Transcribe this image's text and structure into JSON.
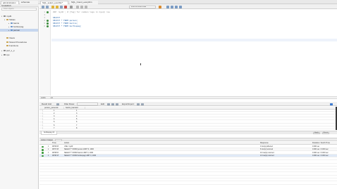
{
  "top_tabs": [
    "administration",
    "schemas",
    "SQL_select_everthin*",
    "SQL_Count_everythin"
  ],
  "sidebar": {
    "header": "SCHEMAS",
    "filter_placeholder": "Filter objects",
    "items": [
      {
        "label": "mydb",
        "level": 0,
        "icon": "database-icon",
        "expanded": true
      },
      {
        "label": "Tables",
        "level": 1,
        "icon": "folder-icon",
        "expanded": true
      },
      {
        "label": "barnis",
        "level": 2,
        "icon": "table-icon"
      },
      {
        "label": "bortkurpag",
        "level": 2,
        "icon": "table-icon"
      },
      {
        "label": "person",
        "level": 2,
        "icon": "table-icon",
        "selected": true
      },
      {
        "label": "Views",
        "level": 1,
        "icon": "folder-icon"
      },
      {
        "label": "Stored Procedures",
        "level": 1,
        "icon": "folder-icon"
      },
      {
        "label": "Functions",
        "level": 1,
        "icon": "folder-icon"
      },
      {
        "label": "perl_s_p",
        "level": 0,
        "icon": "database-icon"
      },
      {
        "label": "sys",
        "level": 0,
        "icon": "database-icon"
      }
    ]
  },
  "editor": {
    "limit_select": "Limit to 1000 rows",
    "lines": [
      {
        "num": "1",
        "code": "USE `mydb`; # [Tag] for common logs in mysql row",
        "kind": "comment",
        "exec": true
      },
      {
        "num": "2",
        "code": "",
        "kind": "plain",
        "exec": false
      },
      {
        "num": "3",
        "code": "SELECT",
        "kind": "keyword",
        "exec": false
      },
      {
        "num": "4",
        "code": "SELECT * FROM person;",
        "kind": "keyword",
        "exec": true
      },
      {
        "num": "5",
        "code": "SELECT * FROM barnis;",
        "kind": "keyword",
        "exec": true
      },
      {
        "num": "6",
        "code": "SELECT * FROM bortkupag;",
        "kind": "keyword",
        "exec": true
      }
    ]
  },
  "editor_status": "100%",
  "editor_status_pos": "1:6",
  "result_toolbar": {
    "result_grid": "Result Grid",
    "filter_rows": "Filter Rows:",
    "edit": "Edit:",
    "export_import": "Export/Import:"
  },
  "grid": {
    "columns": [
      "person_personid",
      "barnis_barnisid"
    ],
    "rows": [
      [
        "1",
        "1"
      ],
      [
        "2",
        "3"
      ],
      [
        "3",
        "4"
      ],
      [
        "4",
        "5"
      ],
      [
        "5",
        "6"
      ],
      [
        "6",
        "7"
      ],
      [
        "7",
        "8"
      ]
    ]
  },
  "result_tab": "bortkupag 13",
  "result_tab_buttons": [
    "Apply",
    "Revert"
  ],
  "output": {
    "header": "Action Output",
    "columns": [
      "",
      "Time",
      "Action",
      "Response",
      "Duration / Fetch Time"
    ],
    "rows": [
      {
        "num": "1",
        "time": "08:56:06",
        "action": "USE `mydb`",
        "response": "0 row(s) affected",
        "duration": "0.000 sec"
      },
      {
        "num": "2",
        "time": "08:57:46",
        "action": "SELECT * FROM person LIMIT 0, 1000",
        "response": "8 row(s) returned",
        "duration": "0.000 sec / 0.000 sec"
      },
      {
        "num": "3",
        "time": "08:58:03",
        "action": "SELECT * FROM barnis LIMIT 0, 1000",
        "response": "10 row(s) returned",
        "duration": "0.000 sec / 0.000 sec"
      },
      {
        "num": "4",
        "time": "08:58:15",
        "action": "SELECT * FROM bortkupag LIMIT 0, 1000",
        "response": "13 row(s) returned",
        "duration": "0.000 sec / 0.000 sec"
      }
    ]
  },
  "colors": {
    "accent_blue": "#1d5ea8",
    "success_green": "#3b9b3b",
    "selection": "#c6d6ee"
  }
}
